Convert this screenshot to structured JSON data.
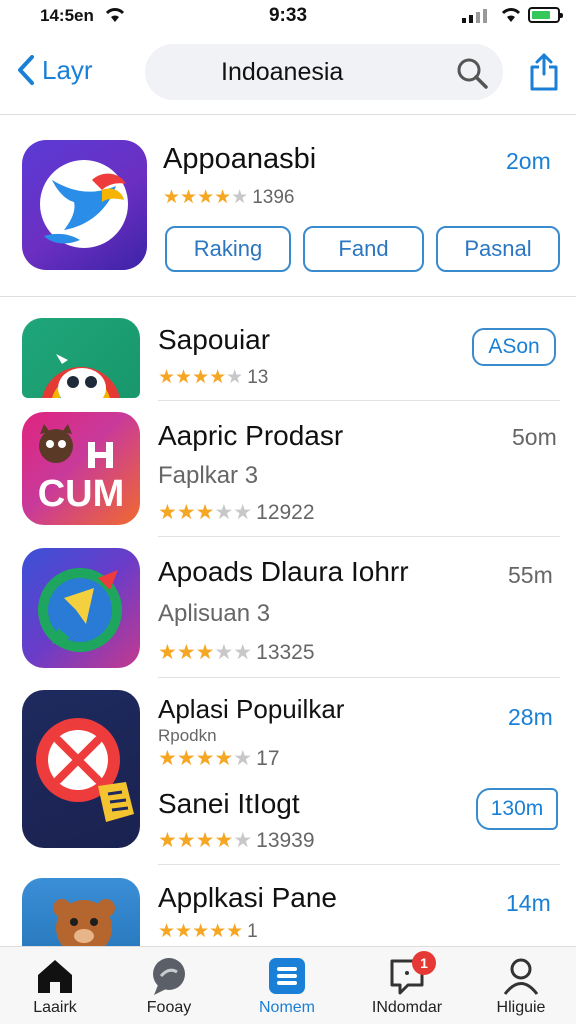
{
  "status_bar": {
    "carrier": "14:5en",
    "time": "9:33"
  },
  "nav": {
    "back_label": "Layr",
    "search_text": "Indoanesia"
  },
  "featured": {
    "title": "Appoanasbi",
    "size": "2om",
    "rating_count": "1396",
    "stars": 4,
    "chips": [
      "Raking",
      "Fand",
      "Pasnal"
    ]
  },
  "apps": [
    {
      "title": "Sapouiar",
      "rating_count": "13",
      "stars": 4,
      "action": "ASon"
    },
    {
      "title": "Aapric Prodasr",
      "subtitle": "Faplkar 3",
      "rating_count": "12922",
      "stars": 3,
      "size": "5om",
      "icon_text": "CUM"
    },
    {
      "title": "Apoads Dlaura Iohrr",
      "subtitle": "Aplisuan 3",
      "rating_count": "13325",
      "stars": 3,
      "size": "55m"
    },
    {
      "title": "Aplasi Popuilkar",
      "subtitle": "Rpodkn",
      "rating_count": "17",
      "stars": 4,
      "size": "28m"
    },
    {
      "title": "Sanei ItIogt",
      "rating_count": "13939",
      "stars": 4,
      "action": "130m"
    },
    {
      "title": "Applkasi Pane",
      "rating_count": "1",
      "stars": 5,
      "size": "14m"
    }
  ],
  "tabs": [
    {
      "label": "Laairk",
      "icon": "home-icon"
    },
    {
      "label": "Fooay",
      "icon": "chat-icon"
    },
    {
      "label": "Nomem",
      "icon": "apps-icon"
    },
    {
      "label": "INdomdar",
      "icon": "notification-icon",
      "badge": "1"
    },
    {
      "label": "Hliguie",
      "icon": "profile-icon"
    }
  ],
  "colors": {
    "accent": "#1a7fd6",
    "star": "#f5a623",
    "badge": "#e53935"
  }
}
